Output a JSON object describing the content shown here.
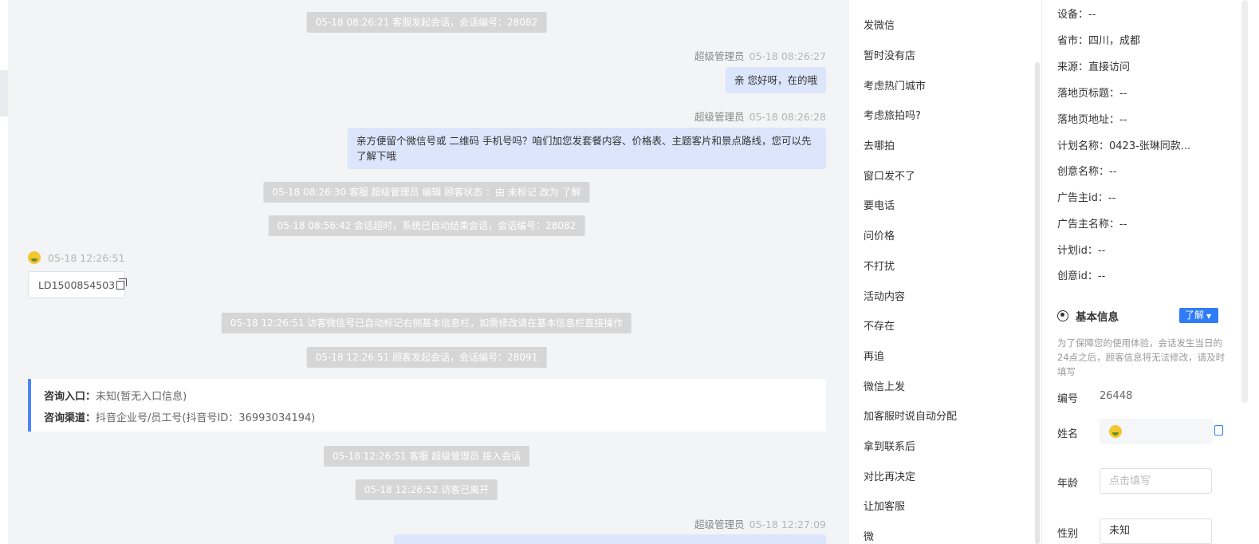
{
  "chat": {
    "system_messages": [
      "05-18 08:26:21 客服发起会话，会话编号：28082",
      "05-18 08:26:30 客服 超级管理员 编辑 顾客状态 ：由 未标记 改为 了解",
      "05-18 08:56:42 会话超时，系统已自动结束会话，会话编号：28082",
      "05-18 12:26:51 访客微信号已自动标记右侧基本信息栏，如需修改请在基本信息栏直接操作",
      "05-18 12:26:51 顾客发起会话，会话编号：28091",
      "05-18 12:26:51 客服 超级管理员 接入会话",
      "05-18 12:26:52 访客已离开"
    ],
    "agent_messages": [
      {
        "sender": "超级管理员",
        "time": "05-18 08:26:27",
        "text": "亲 您好呀，在的哦"
      },
      {
        "sender": "超级管理员",
        "time": "05-18 08:26:28",
        "text": "亲方便留个微信号或 二维码 手机号吗？咱们加您发套餐内容、价格表、主题客片和景点路线，您可以先了解下哦"
      },
      {
        "sender": "超级管理员",
        "time": "05-18 12:27:09",
        "text": ""
      }
    ],
    "visitor_message": {
      "time": "05-18 12:26:51",
      "wechat_id": "LD1500854503"
    },
    "consult_card": {
      "entry_label": "咨询入口：",
      "entry_value": "未知(暂无入口信息)",
      "channel_label": "咨询渠道：",
      "channel_value": "抖音企业号/员工号(抖音号ID：36993034194)"
    }
  },
  "quick_replies": [
    "发微信",
    "暂时没有店",
    "考虑热门城市",
    "考虑旅拍吗?",
    "去哪拍",
    "窗口发不了",
    "要电话",
    "问价格",
    "不打扰",
    "活动内容",
    "不存在",
    "再追",
    "微信上发",
    "加客服时说自动分配",
    "拿到联系后",
    "对比再决定",
    "让加客服",
    "微"
  ],
  "panel": {
    "source_info": [
      {
        "label": "设备：",
        "value": "--"
      },
      {
        "label": "省市：",
        "value": "四川，成都"
      },
      {
        "label": "来源：",
        "value": "直接访问"
      },
      {
        "label": "落地页标题：",
        "value": "--"
      },
      {
        "label": "落地页地址：",
        "value": "--"
      },
      {
        "label": "计划名称：",
        "value": "0423-张琳同款..."
      },
      {
        "label": "创意名称：",
        "value": "--"
      },
      {
        "label": "广告主id：",
        "value": "--"
      },
      {
        "label": "广告主名称：",
        "value": "--"
      },
      {
        "label": "计划id：",
        "value": "--"
      },
      {
        "label": "创意id：",
        "value": "--"
      }
    ],
    "basic_info": {
      "title": "基本信息",
      "status": "了解",
      "notice": "为了保障您的使用体验，会话发生当日的24点之后，顾客信息将无法修改，请及时填写",
      "id_label": "编号",
      "id_value": "26448",
      "name_label": "姓名",
      "age_label": "年龄",
      "age_placeholder": "点击填写",
      "gender_label": "性别",
      "gender_value": "未知"
    }
  },
  "colors": {
    "accent": "#2f7cf6",
    "bubble": "#dbe6fc",
    "system_pill": "#d6d6d6",
    "chat_bg": "#f3f4f6"
  }
}
